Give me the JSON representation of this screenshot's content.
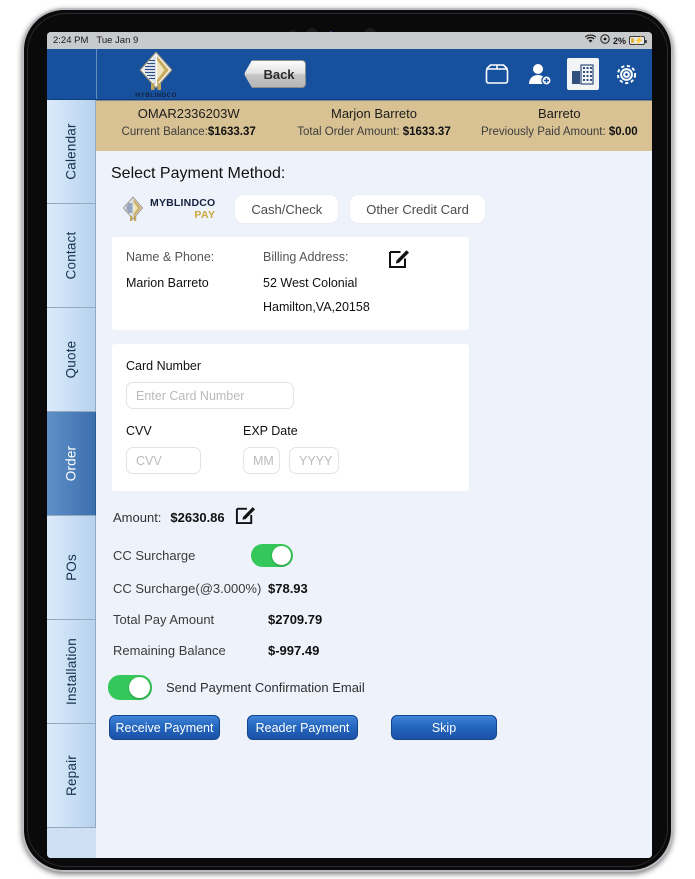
{
  "status_bar": {
    "time": "2:24 PM",
    "date": "Tue Jan 9",
    "battery_percent": "2%",
    "wifi_icon": "wifi-icon",
    "location_icon": "location-circle-icon",
    "battery_icon": "battery-charging-icon"
  },
  "app_bar": {
    "logo_text": "MYBLINDCO",
    "back_label": "Back",
    "icons": [
      {
        "name": "box-icon",
        "label": "Orders"
      },
      {
        "name": "add-user-icon",
        "label": "Add Customer"
      },
      {
        "name": "building-icon",
        "label": "Company"
      },
      {
        "name": "gear-icon",
        "label": "Settings"
      }
    ]
  },
  "sidebar": {
    "items": [
      {
        "label": "Calendar",
        "selected": false
      },
      {
        "label": "Contact",
        "selected": false
      },
      {
        "label": "Quote",
        "selected": false
      },
      {
        "label": "Order",
        "selected": true
      },
      {
        "label": "POs",
        "selected": false
      },
      {
        "label": "Installation",
        "selected": false
      },
      {
        "label": "Repair",
        "selected": false
      }
    ]
  },
  "info_bar": {
    "order_number": "OMAR2336203W",
    "customer_name": "Marjon Barreto",
    "last_name": "Barreto",
    "current_balance_label": "Current Balance:",
    "current_balance_value": "$1633.37",
    "total_order_label": "Total Order Amount:",
    "total_order_value": "$1633.37",
    "previously_paid_label": "Previously Paid Amount:",
    "previously_paid_value": "$0.00"
  },
  "main": {
    "section_title": "Select Payment Method:",
    "payment_methods": [
      {
        "name": "myblindco-pay",
        "logo_top": "MYBLINDCO",
        "logo_bottom": "PAY"
      },
      {
        "name": "cash-check",
        "label": "Cash/Check"
      },
      {
        "name": "other-credit-card",
        "label": "Other Credit Card"
      }
    ],
    "billing": {
      "name_phone_label": "Name & Phone:",
      "name_phone_value": "Marion Barreto",
      "billing_address_label": "Billing Address:",
      "address_line1": "52 West Colonial",
      "address_line2": "Hamilton,VA,20158",
      "edit_icon": "edit-pencil-icon"
    },
    "card": {
      "card_number_label": "Card Number",
      "card_number_value": "",
      "card_number_placeholder": "Enter Card Number",
      "cvv_label": "CVV",
      "cvv_value": "",
      "cvv_placeholder": "CVV",
      "exp_label": "EXP Date",
      "exp_month_value": "",
      "exp_month_placeholder": "MM",
      "exp_year_value": "",
      "exp_year_placeholder": "YYYY"
    },
    "amount": {
      "amount_label": "Amount:",
      "amount_value": "$2630.86",
      "edit_icon": "edit-pencil-icon",
      "cc_surcharge_label": "CC Surcharge",
      "cc_surcharge_toggle": "on",
      "cc_surcharge_rate_label": "CC Surcharge(@3.000%)",
      "cc_surcharge_value": "$78.93",
      "total_pay_label": "Total Pay Amount",
      "total_pay_value": "$2709.79",
      "remaining_label": "Remaining Balance",
      "remaining_value": "$-997.49"
    },
    "email": {
      "toggle": "on",
      "label": "Send Payment Confirmation Email"
    },
    "buttons": {
      "receive": "Receive Payment",
      "reader": "Reader Payment",
      "skip": "Skip"
    }
  },
  "colors": {
    "app_bar_blue": "#17519e",
    "info_bar_tan": "#d8c293",
    "content_bg": "#eef2fb",
    "sidebar_selected": "#3c6fae",
    "toggle_green": "#34c759",
    "button_blue": "#2567bf"
  }
}
